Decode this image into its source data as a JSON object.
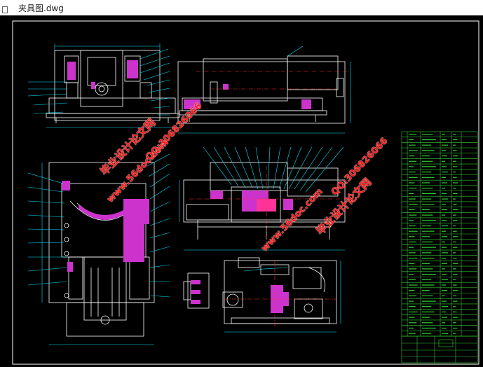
{
  "window": {
    "file_name": "夹具图.dwg"
  },
  "watermarks": [
    {
      "text": "毕业设计论文网",
      "color": "#ff1a1a"
    },
    {
      "text": "www.56doc.com",
      "color": "#ff1a1a"
    },
    {
      "text": "QQ:306826066",
      "color": "#ff1a1a"
    },
    {
      "text": "www.56doc.com",
      "color": "#ff1a1a"
    },
    {
      "text": "QQ:306826066",
      "color": "#ff1a1a"
    },
    {
      "text": "毕业设计论文网",
      "color": "#ff1a1a"
    }
  ],
  "colors": {
    "background": "#000000",
    "frame": "#ffffff",
    "lines": "#ffffff",
    "dimensions": "#00e5ff",
    "hatch": "#cc33cc",
    "centerline": "#ff3333",
    "table": "#33cc33"
  }
}
